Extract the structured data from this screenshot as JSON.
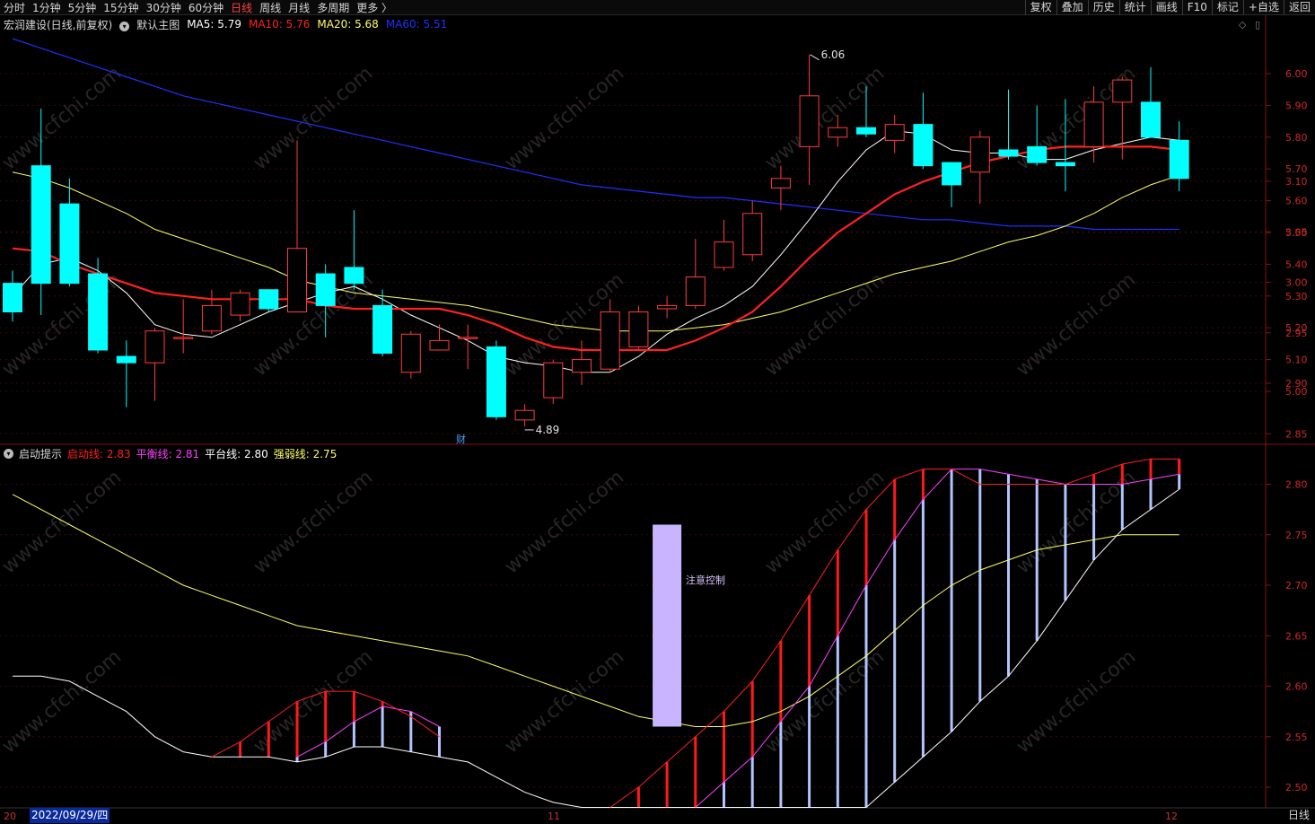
{
  "toolbar": {
    "periods": [
      "分时",
      "1分钟",
      "5分钟",
      "15分钟",
      "30分钟",
      "60分钟",
      "日线",
      "周线",
      "月线",
      "多周期",
      "更多 〉"
    ],
    "active_period": "日线",
    "actions": [
      "复权",
      "叠加",
      "历史",
      "统计",
      "画线",
      "F10",
      "标记",
      "+自选",
      "返回"
    ]
  },
  "main_legend": {
    "title": "宏润建设(日线,前复权)",
    "template": "默认主图",
    "ma5": "MA5: 5.79",
    "ma10": "MA10: 5.76",
    "ma20": "MA20: 5.68",
    "ma60": "MA60: 5.51"
  },
  "indicator_legend": {
    "name": "启动提示",
    "line1": "启动线: 2.83",
    "line2": "平衡线: 2.81",
    "line3": "平台线: 2.80",
    "line4": "强弱线: 2.75"
  },
  "annotations": {
    "high": "6.06",
    "low": "4.89",
    "finance_mark": "财",
    "warning": "注意控制"
  },
  "axis": {
    "price_ticks": [
      "6.00",
      "5.90",
      "5.80",
      "5.70",
      "5.60",
      "5.50",
      "5.40",
      "5.30",
      "5.20",
      "5.10",
      "5.00"
    ],
    "indicator_ticks": [
      "3.10",
      "3.05",
      "3.00",
      "2.95",
      "2.90",
      "2.85",
      "2.80",
      "2.75",
      "2.70",
      "2.65",
      "2.60",
      "2.55",
      "2.50"
    ],
    "date_labels": [
      "20",
      "0",
      "11",
      "12"
    ],
    "cursor_date": "2022/09/29/四",
    "period_label": "日线"
  },
  "watermark": "www.cfchi.com",
  "colors": {
    "up": "#ff3b3b",
    "down": "#00ffff",
    "ma5": "#ffffff",
    "ma10": "#ff2020",
    "ma20": "#ffff66",
    "ma60": "#2030ff",
    "balance": "#ff40ff",
    "ind_fill": "#b0c4ff"
  },
  "chart_data": {
    "type": "candlestick",
    "price_axis": {
      "min": 4.89,
      "max": 6.06
    },
    "candles": [
      [
        5.34,
        5.25,
        5.38,
        5.22
      ],
      [
        5.71,
        5.34,
        5.89,
        5.24
      ],
      [
        5.59,
        5.34,
        5.67,
        5.33
      ],
      [
        5.37,
        5.13,
        5.42,
        5.12
      ],
      [
        5.11,
        5.09,
        5.16,
        4.95
      ],
      [
        5.09,
        5.19,
        5.2,
        4.97
      ],
      [
        5.17,
        5.17,
        5.29,
        5.12
      ],
      [
        5.19,
        5.27,
        5.32,
        5.18
      ],
      [
        5.24,
        5.31,
        5.32,
        5.22
      ],
      [
        5.32,
        5.26,
        5.32,
        5.25
      ],
      [
        5.25,
        5.45,
        5.79,
        5.25
      ],
      [
        5.37,
        5.27,
        5.4,
        5.17
      ],
      [
        5.39,
        5.34,
        5.57,
        5.32
      ],
      [
        5.27,
        5.12,
        5.32,
        5.11
      ],
      [
        5.06,
        5.18,
        5.19,
        5.04
      ],
      [
        5.13,
        5.16,
        5.21,
        5.13
      ],
      [
        5.17,
        5.17,
        5.21,
        5.07
      ],
      [
        5.14,
        4.92,
        5.16,
        4.91
      ],
      [
        4.91,
        4.94,
        4.96,
        4.89
      ],
      [
        4.98,
        5.09,
        5.1,
        4.96
      ],
      [
        5.06,
        5.1,
        5.16,
        5.02
      ],
      [
        5.07,
        5.25,
        5.29,
        5.06
      ],
      [
        5.14,
        5.25,
        5.27,
        5.13
      ],
      [
        5.26,
        5.27,
        5.3,
        5.23
      ],
      [
        5.27,
        5.36,
        5.48,
        5.26
      ],
      [
        5.39,
        5.47,
        5.54,
        5.38
      ],
      [
        5.43,
        5.56,
        5.6,
        5.41
      ],
      [
        5.64,
        5.67,
        5.71,
        5.57
      ],
      [
        5.77,
        5.93,
        6.06,
        5.65
      ],
      [
        5.8,
        5.83,
        5.87,
        5.77
      ],
      [
        5.83,
        5.81,
        5.96,
        5.8
      ],
      [
        5.79,
        5.84,
        5.87,
        5.75
      ],
      [
        5.84,
        5.71,
        5.94,
        5.7
      ],
      [
        5.72,
        5.65,
        5.72,
        5.58
      ],
      [
        5.69,
        5.8,
        5.82,
        5.59
      ],
      [
        5.76,
        5.74,
        5.95,
        5.73
      ],
      [
        5.77,
        5.72,
        5.9,
        5.71
      ],
      [
        5.72,
        5.71,
        5.92,
        5.63
      ],
      [
        5.77,
        5.91,
        5.96,
        5.72
      ],
      [
        5.91,
        5.98,
        5.99,
        5.73
      ],
      [
        5.91,
        5.8,
        6.02,
        5.8
      ],
      [
        5.79,
        5.67,
        5.85,
        5.63
      ]
    ],
    "ma5": [
      5.3,
      5.4,
      5.42,
      5.38,
      5.31,
      5.21,
      5.18,
      5.17,
      5.21,
      5.25,
      5.28,
      5.31,
      5.33,
      5.29,
      5.24,
      5.2,
      5.16,
      5.11,
      5.09,
      5.08,
      5.06,
      5.06,
      5.11,
      5.18,
      5.23,
      5.27,
      5.33,
      5.43,
      5.54,
      5.66,
      5.76,
      5.82,
      5.81,
      5.76,
      5.75,
      5.75,
      5.73,
      5.73,
      5.76,
      5.78,
      5.8,
      5.79
    ],
    "ma10": [
      5.45,
      5.44,
      5.4,
      5.37,
      5.34,
      5.31,
      5.3,
      5.29,
      5.29,
      5.29,
      5.29,
      5.27,
      5.26,
      5.26,
      5.26,
      5.26,
      5.24,
      5.21,
      5.17,
      5.14,
      5.13,
      5.13,
      5.13,
      5.13,
      5.16,
      5.2,
      5.25,
      5.33,
      5.42,
      5.5,
      5.56,
      5.62,
      5.66,
      5.69,
      5.72,
      5.74,
      5.76,
      5.77,
      5.77,
      5.77,
      5.77,
      5.76
    ],
    "ma20": [
      5.69,
      5.67,
      5.64,
      5.6,
      5.56,
      5.51,
      5.48,
      5.45,
      5.42,
      5.39,
      5.35,
      5.33,
      5.31,
      5.3,
      5.29,
      5.28,
      5.27,
      5.25,
      5.23,
      5.21,
      5.2,
      5.19,
      5.19,
      5.19,
      5.2,
      5.21,
      5.23,
      5.25,
      5.28,
      5.31,
      5.34,
      5.37,
      5.39,
      5.41,
      5.44,
      5.47,
      5.49,
      5.52,
      5.56,
      5.61,
      5.65,
      5.68
    ],
    "ma60": [
      6.11,
      6.08,
      6.05,
      6.02,
      5.99,
      5.96,
      5.93,
      5.91,
      5.89,
      5.87,
      5.85,
      5.83,
      5.81,
      5.79,
      5.77,
      5.75,
      5.73,
      5.71,
      5.69,
      5.67,
      5.65,
      5.64,
      5.63,
      5.62,
      5.61,
      5.61,
      5.6,
      5.59,
      5.58,
      5.57,
      5.56,
      5.55,
      5.54,
      5.54,
      5.53,
      5.52,
      5.52,
      5.52,
      5.51,
      5.51,
      5.51,
      5.51
    ],
    "indicator": {
      "axis": {
        "min": 2.48,
        "max": 3.13
      },
      "strong_weak": [
        2.79,
        2.775,
        2.76,
        2.745,
        2.73,
        2.715,
        2.7,
        2.69,
        2.68,
        2.67,
        2.66,
        2.655,
        2.65,
        2.645,
        2.64,
        2.635,
        2.63,
        2.62,
        2.61,
        2.6,
        2.59,
        2.58,
        2.57,
        2.565,
        2.56,
        2.56,
        2.565,
        2.575,
        2.59,
        2.61,
        2.63,
        2.655,
        2.68,
        2.7,
        2.715,
        2.725,
        2.735,
        2.74,
        2.745,
        2.75,
        2.75,
        2.75
      ],
      "platform": [
        2.61,
        2.61,
        2.605,
        2.59,
        2.575,
        2.55,
        2.535,
        2.53,
        2.53,
        2.53,
        2.525,
        2.53,
        2.54,
        2.54,
        2.535,
        2.53,
        2.525,
        2.51,
        2.495,
        2.485,
        2.48,
        2.48,
        2.48,
        2.48,
        2.48,
        2.48,
        2.48,
        2.48,
        2.48,
        2.48,
        2.48,
        2.505,
        2.53,
        2.555,
        2.585,
        2.61,
        2.645,
        2.685,
        2.725,
        2.755,
        2.775,
        2.795
      ],
      "launch": [
        null,
        null,
        null,
        null,
        null,
        null,
        null,
        2.53,
        2.545,
        2.565,
        2.585,
        2.595,
        2.595,
        2.585,
        2.57,
        2.55,
        null,
        null,
        null,
        null,
        null,
        2.48,
        2.5,
        2.525,
        2.55,
        2.575,
        2.605,
        2.645,
        2.69,
        2.735,
        2.775,
        2.805,
        2.815,
        2.815,
        2.8,
        2.8,
        2.8,
        2.8,
        2.81,
        2.82,
        2.825,
        2.825
      ],
      "balance": [
        null,
        null,
        null,
        null,
        null,
        null,
        null,
        null,
        null,
        null,
        2.53,
        2.545,
        2.565,
        2.58,
        2.575,
        2.56,
        null,
        null,
        null,
        null,
        null,
        null,
        null,
        null,
        2.48,
        2.505,
        2.53,
        2.565,
        2.6,
        2.65,
        2.7,
        2.745,
        2.785,
        2.815,
        2.815,
        2.81,
        2.805,
        2.8,
        2.8,
        2.8,
        2.805,
        2.81
      ],
      "bar": {
        "index": 23,
        "top": 2.76,
        "bottom": 2.56
      }
    }
  }
}
